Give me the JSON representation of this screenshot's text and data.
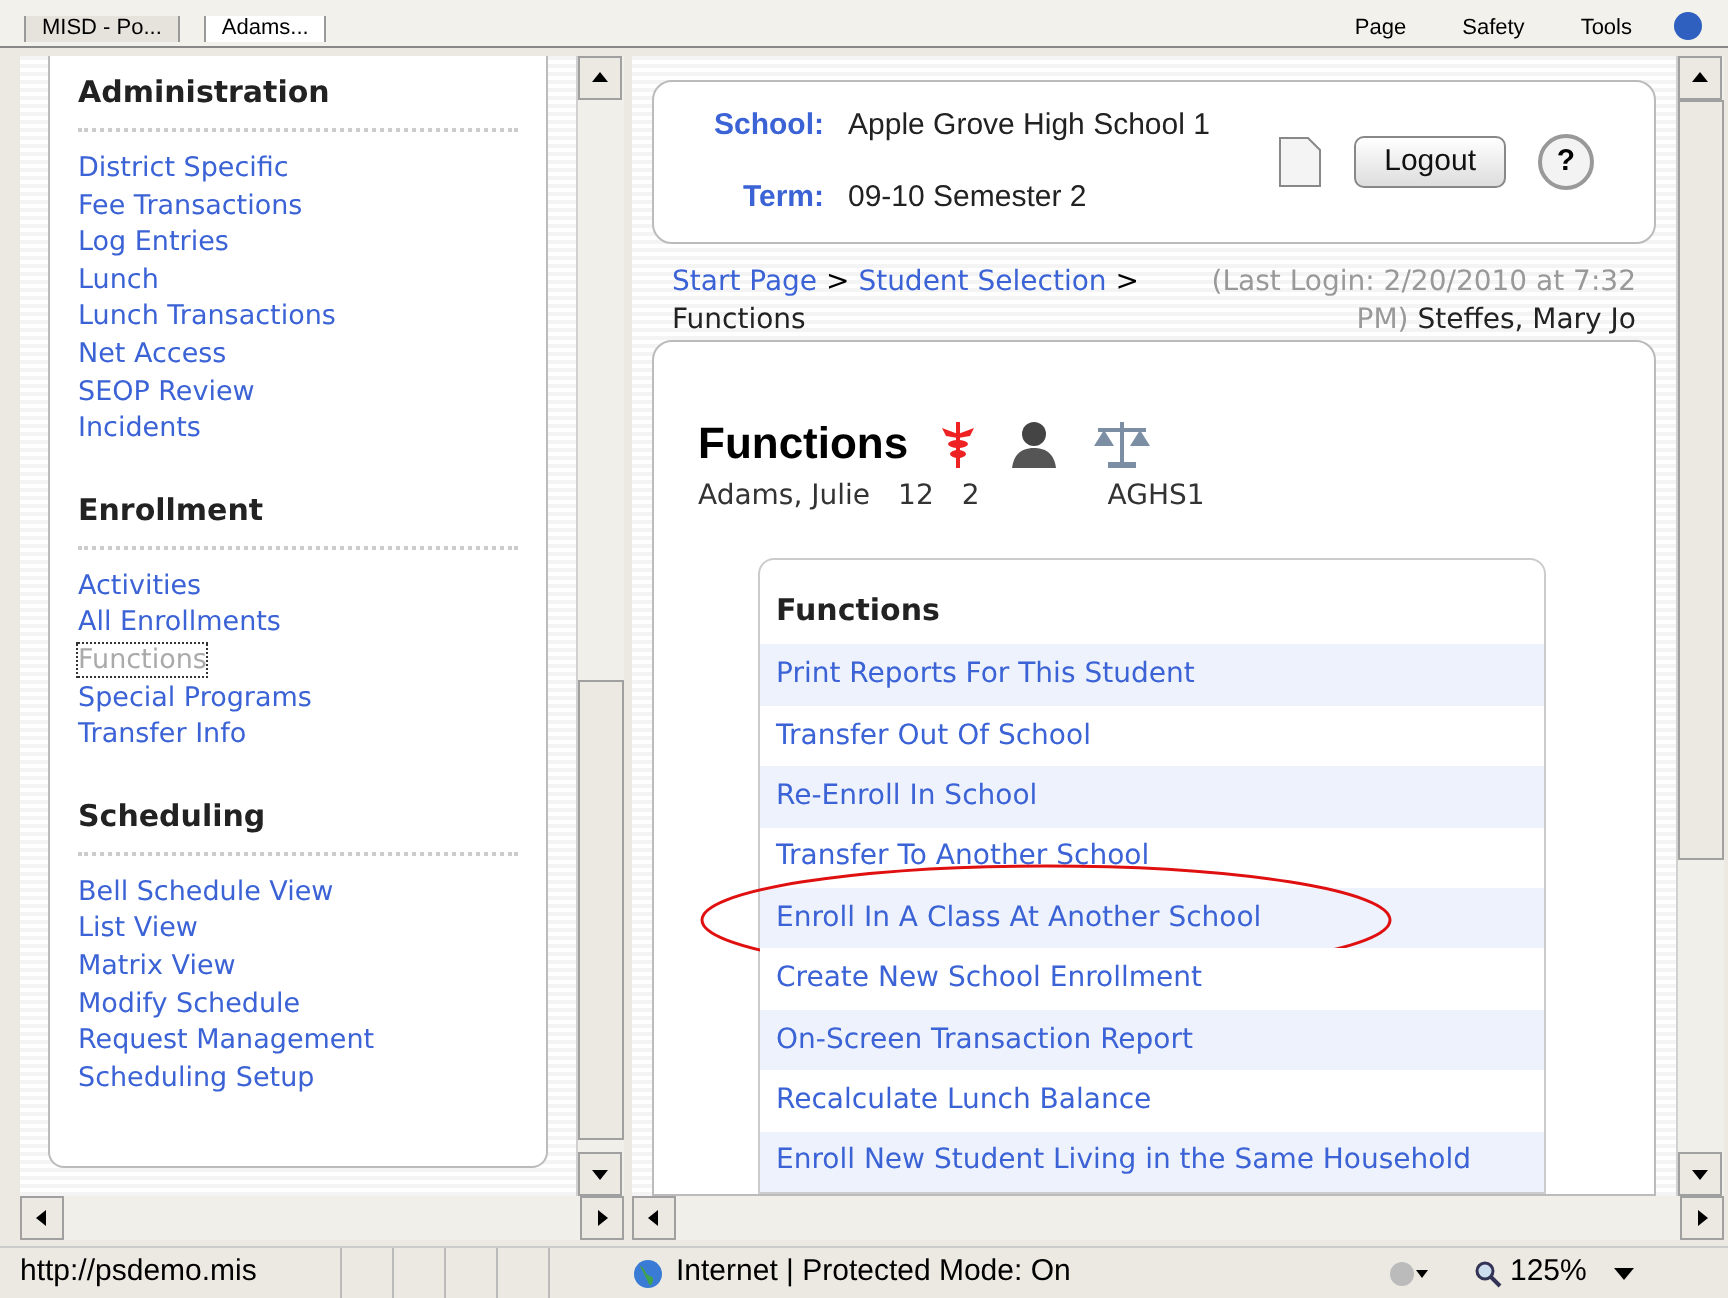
{
  "browser_tabs": [
    {
      "label": "MISD - Po...",
      "selected": false
    },
    {
      "label": "Adams...",
      "selected": true
    }
  ],
  "toolbar": {
    "items": [
      "Page",
      "Safety",
      "Tools"
    ]
  },
  "sidebar": {
    "sections": [
      {
        "title": "Administration",
        "items": [
          {
            "label": "District Specific",
            "selected": false
          },
          {
            "label": "Fee Transactions",
            "selected": false
          },
          {
            "label": "Log Entries",
            "selected": false
          },
          {
            "label": "Lunch",
            "selected": false
          },
          {
            "label": "Lunch Transactions",
            "selected": false
          },
          {
            "label": "Net Access",
            "selected": false
          },
          {
            "label": "SEOP Review",
            "selected": false
          },
          {
            "label": "Incidents",
            "selected": false
          }
        ]
      },
      {
        "title": "Enrollment",
        "items": [
          {
            "label": "Activities",
            "selected": false
          },
          {
            "label": "All Enrollments",
            "selected": false
          },
          {
            "label": "Functions",
            "selected": true
          },
          {
            "label": "Special Programs",
            "selected": false
          },
          {
            "label": "Transfer Info",
            "selected": false
          }
        ]
      },
      {
        "title": "Scheduling",
        "items": [
          {
            "label": "Bell Schedule View",
            "selected": false
          },
          {
            "label": "List View",
            "selected": false
          },
          {
            "label": "Matrix View",
            "selected": false
          },
          {
            "label": "Modify Schedule",
            "selected": false
          },
          {
            "label": "Request Management",
            "selected": false
          },
          {
            "label": "Scheduling Setup",
            "selected": false
          }
        ]
      }
    ]
  },
  "header": {
    "school_label": "School:",
    "school": "Apple Grove High School 1",
    "term_label": "Term:",
    "term": "09-10 Semester 2",
    "logout": "Logout",
    "help": "?"
  },
  "breadcrumb": {
    "links": [
      "Start Page",
      "Student Selection"
    ],
    "separator": ">",
    "current": "Functions",
    "last_login": "(Last Login: 2/20/2010 at 7:32 PM)",
    "user": "Steffes, Mary Jo"
  },
  "page": {
    "title": "Functions",
    "student": [
      "Adams, Julie",
      "12",
      "2",
      "AGHS1"
    ]
  },
  "functions_table": {
    "heading": "Functions",
    "rows": [
      {
        "label": "Print Reports For This Student",
        "circled": false
      },
      {
        "label": "Transfer Out Of School",
        "circled": false
      },
      {
        "label": "Re-Enroll In School",
        "circled": false
      },
      {
        "label": "Transfer To Another School",
        "circled": false
      },
      {
        "label": "Enroll In A Class At Another School",
        "circled": true
      },
      {
        "label": "Create New School Enrollment",
        "circled": false
      },
      {
        "label": "On-Screen Transaction Report",
        "circled": false
      },
      {
        "label": "Recalculate Lunch Balance",
        "circled": false
      },
      {
        "label": "Enroll New Student Living in the Same Household",
        "circled": false
      }
    ]
  },
  "status_bar": {
    "url": "http://psdemo.mis",
    "zone": "Internet | Protected Mode: On",
    "zoom": "125%"
  }
}
